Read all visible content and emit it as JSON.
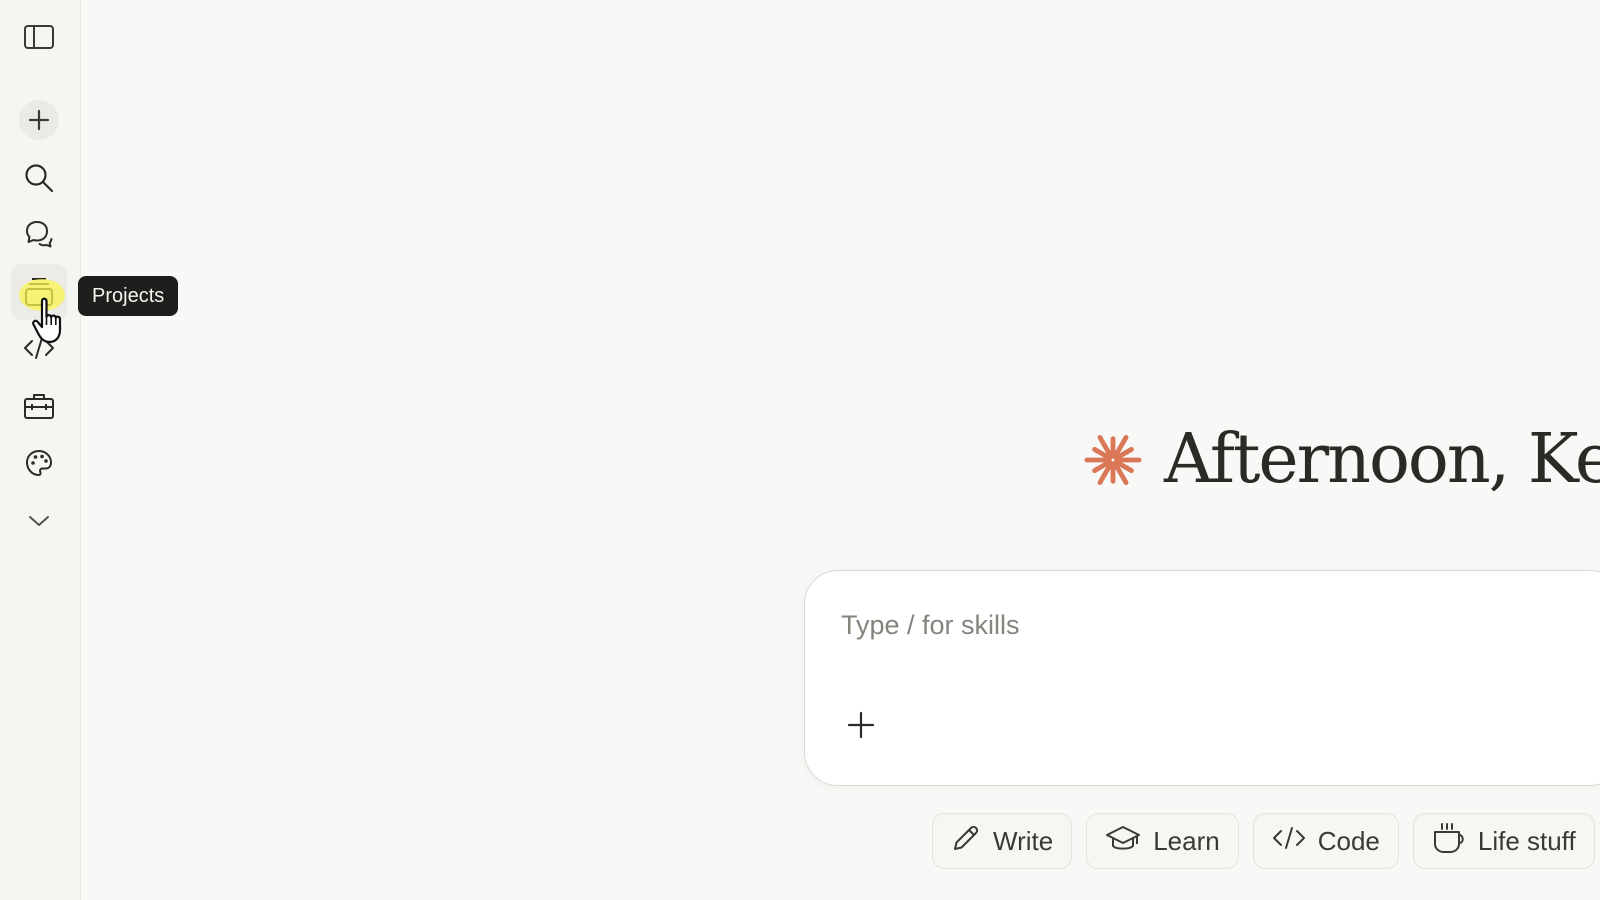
{
  "sidebar": {
    "icons": [
      {
        "name": "sidebar-toggle-icon"
      },
      {
        "name": "plus-icon"
      },
      {
        "name": "search-icon"
      },
      {
        "name": "chats-icon"
      },
      {
        "name": "projects-icon"
      },
      {
        "name": "code-icon"
      },
      {
        "name": "toolbox-icon"
      },
      {
        "name": "palette-icon"
      },
      {
        "name": "chevron-down-icon"
      }
    ],
    "tooltip": "Projects"
  },
  "greeting": {
    "text": "Afternoon, Ke",
    "icon": "sparkle-icon",
    "icon_color": "#d97757"
  },
  "composer": {
    "placeholder": "Type / for skills",
    "value": ""
  },
  "chips": [
    {
      "label": "Write",
      "icon": "pencil-icon"
    },
    {
      "label": "Learn",
      "icon": "graduation-cap-icon"
    },
    {
      "label": "Code",
      "icon": "code-icon"
    },
    {
      "label": "Life stuff",
      "icon": "coffee-cup-icon"
    }
  ],
  "colors": {
    "background": "#f8f8f6",
    "accent": "#d97757",
    "tooltip_bg": "#1f1e1c",
    "highlight": "#faf450"
  }
}
